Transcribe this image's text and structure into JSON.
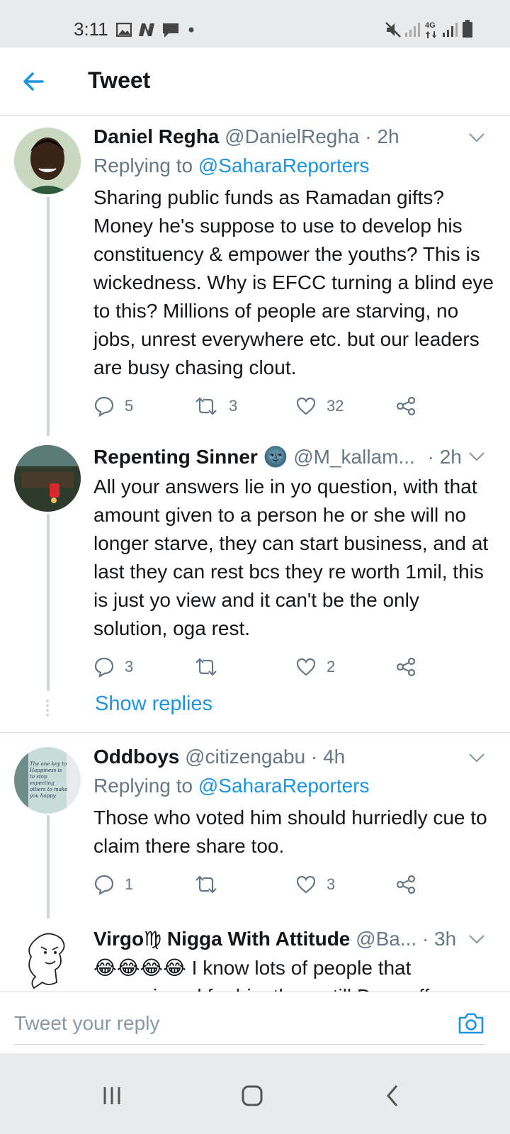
{
  "status_bar": {
    "time": "3:11",
    "network": "4G"
  },
  "header": {
    "title": "Tweet"
  },
  "tweets": [
    {
      "name": "Daniel Regha",
      "handle": "@DanielRegha",
      "time": "· 2h",
      "replying_prefix": "Replying to ",
      "replying_to": "@SaharaReporters",
      "text": "Sharing public funds as Ramadan gifts? Money he's suppose to use to develop his constituency & empower the youths? This is wickedness. Why is EFCC turning a blind eye to this? Millions of people are starving, no jobs, unrest everywhere etc. but our leaders are busy chasing clout.",
      "replies": "5",
      "retweets": "3",
      "likes": "32"
    },
    {
      "name": "Repenting Sinner",
      "name_emoji": "🌚",
      "handle": "@M_kallam...",
      "time": "· 2h",
      "text": "All your answers lie in yo question, with that amount given to a person he or she will no longer starve, they can start business, and at last they can rest bcs they re worth 1mil, this is just yo view and it can't be the only solution, oga rest.",
      "replies": "3",
      "retweets": "",
      "likes": "2",
      "show_replies": "Show replies"
    },
    {
      "name": "Oddboys",
      "handle": "@citizengabu",
      "time": "· 4h",
      "replying_prefix": "Replying to ",
      "replying_to": "@SaharaReporters",
      "text": "Those who voted him should hurriedly cue to claim there share too.",
      "replies": "1",
      "retweets": "",
      "likes": "3",
      "avatar_text": "The one key to Happiness is to stop expecting others to make you happy"
    },
    {
      "name": "Virgo♍ Nigga With Attitude",
      "handle": "@Ba...",
      "time": "· 3h",
      "text_emoji": "😂😂😂😂",
      "text": "I know lots of people that campaigned for him them still Dey suffer"
    }
  ],
  "reply_bar": {
    "placeholder": "Tweet your reply"
  },
  "colors": {
    "accent": "#1b95e0",
    "secondary_text": "#657786",
    "divider": "#d7dbdf"
  }
}
